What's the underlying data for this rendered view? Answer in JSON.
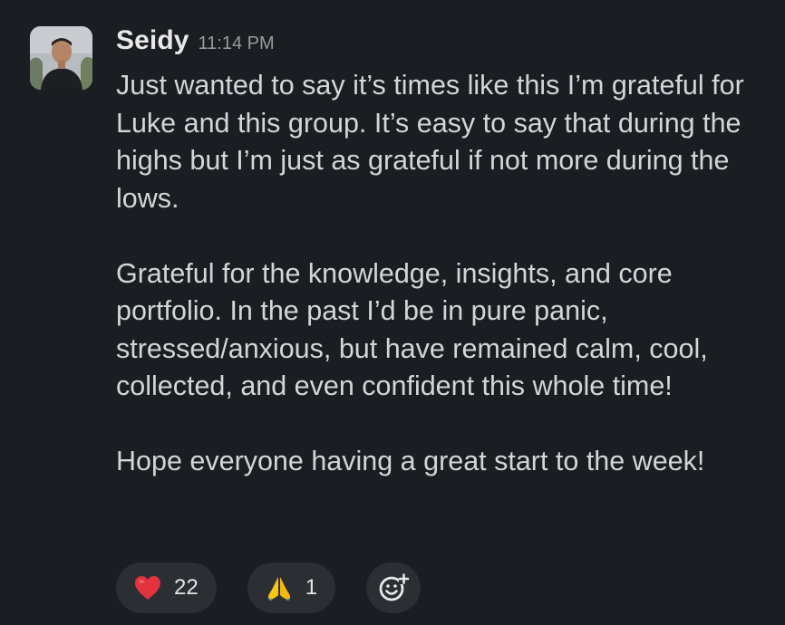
{
  "message": {
    "sender": "Seidy",
    "timestamp": "11:14 PM",
    "paragraphs": [
      "Just wanted to say it’s times like this I’m grateful for Luke and this group. It’s easy to say that during the highs but I’m just as grateful if not more during the lows.",
      "Grateful for the knowledge, insights, and core portfolio. In the past I’d be in pure panic, stressed/anxious, but have remained calm, cool, collected, and even confident this whole time!",
      "Hope everyone having a great start to the week!"
    ]
  },
  "reactions": [
    {
      "emoji": "heart-emoji",
      "count": "22"
    },
    {
      "emoji": "folded-hands-emoji",
      "count": "1"
    }
  ],
  "add_reaction_icon": "add-reaction-icon",
  "colors": {
    "background": "#1a1d21",
    "reaction_pill": "#2b2e33",
    "heart": "#e2333f",
    "hands": "#f5c518"
  }
}
